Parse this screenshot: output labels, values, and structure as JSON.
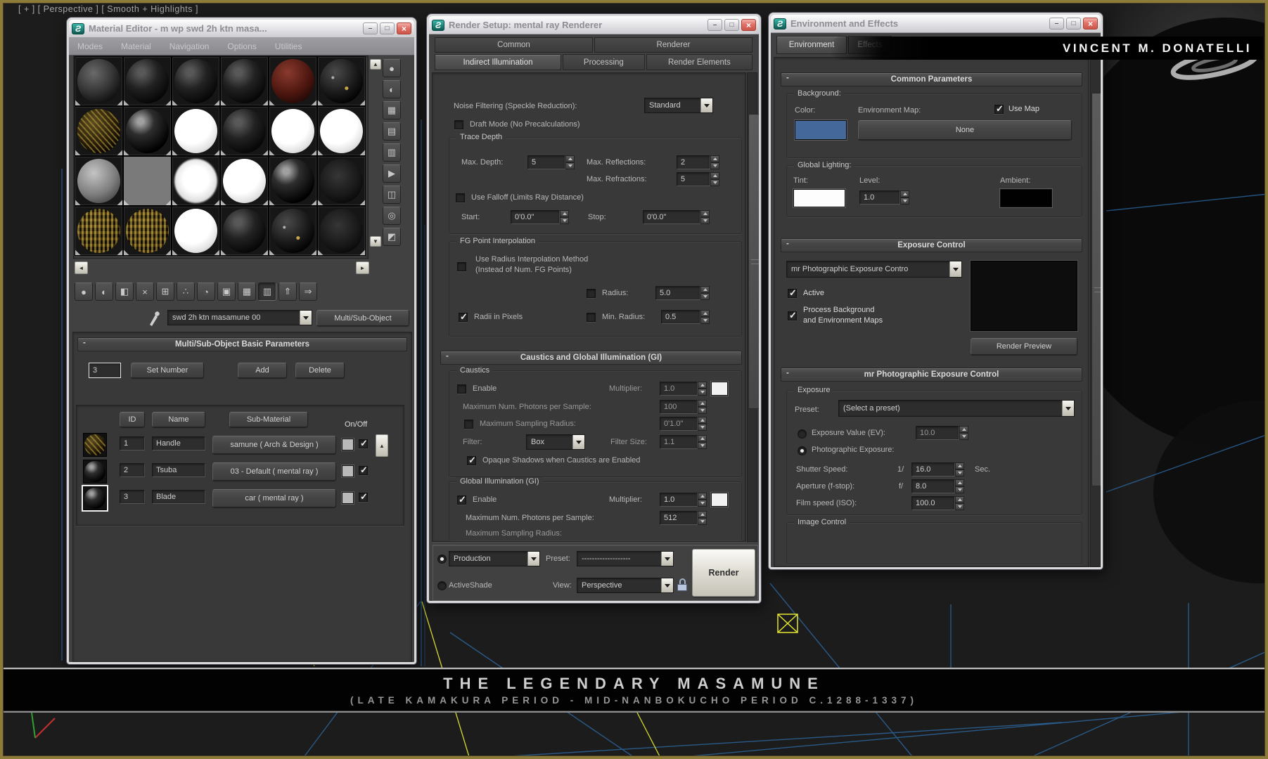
{
  "icons": {
    "minimize": "–",
    "maximize": "□",
    "close": "×",
    "check": "✓",
    "collapse": "-",
    "scroll_left": "◄",
    "scroll_right": "►",
    "scroll_up": "▲",
    "scroll_down": "▼",
    "dropdown_arrow": "▼",
    "app_logo": "Ƨ"
  },
  "colors": {
    "background_swatch": "#44689a",
    "tint_swatch": "#fdfdfd",
    "ambient_swatch": "#010101",
    "caustics_multiplier_swatch": "#f2f2f2",
    "gi_multiplier_swatch": "#f2f2f2",
    "sub_material_swatch": "#b9b9b9"
  },
  "viewport": {
    "label": "[ + ] [ Perspective ] [ Smooth + Highlights ]"
  },
  "overlay": {
    "credit": "VINCENT M. DONATELLI",
    "banner_title": "THE LEGENDARY MASAMUNE",
    "banner_subtitle": "(LATE KAMAKURA PERIOD - MID-NANBOKUCHO PERIOD C.1288-1337)"
  },
  "material_editor": {
    "title": "Material Editor - m wp swd 2h ktn masa...",
    "menus": [
      "Modes",
      "Material",
      "Navigation",
      "Options",
      "Utilities"
    ],
    "sample_slots": [
      "smoke",
      "black",
      "black",
      "black",
      "red",
      "speckle",
      "goldfleck",
      "gloss",
      "white",
      "black",
      "white",
      "white",
      "grey",
      "flat",
      "whitesoft",
      "white",
      "gloss",
      "darkdim",
      "gold",
      "gold",
      "white",
      "black",
      "speckle",
      "darkdim"
    ],
    "side_tools": [
      {
        "name": "sample-type",
        "glyph": "●"
      },
      {
        "name": "backlight",
        "glyph": "◐"
      },
      {
        "name": "background",
        "glyph": "▦"
      },
      {
        "name": "sample-uv-tiling",
        "glyph": "▤"
      },
      {
        "name": "video-color-check",
        "glyph": "▥"
      },
      {
        "name": "make-preview",
        "glyph": "▶"
      },
      {
        "name": "material-editor-options",
        "glyph": "◫"
      },
      {
        "name": "select-by-material",
        "glyph": "◎"
      },
      {
        "name": "material-map-navigator",
        "glyph": "◩"
      }
    ],
    "toolbar": [
      {
        "name": "get-material",
        "glyph": "●"
      },
      {
        "name": "put-material-to-scene",
        "glyph": "◐"
      },
      {
        "name": "assign-material-to-selection",
        "glyph": "◧"
      },
      {
        "name": "reset-map",
        "glyph": "×"
      },
      {
        "name": "make-material-copy",
        "glyph": "⊞"
      },
      {
        "name": "make-unique",
        "glyph": "∴"
      },
      {
        "name": "put-to-library",
        "glyph": "◔"
      },
      {
        "name": "material-id-channel",
        "glyph": "▣"
      },
      {
        "name": "show-map-in-viewport",
        "glyph": "▦"
      },
      {
        "name": "show-end-result",
        "glyph": "▥",
        "pressed": true
      },
      {
        "name": "go-to-parent",
        "glyph": "⇑"
      },
      {
        "name": "go-forward-to-sibling",
        "glyph": "⇒"
      }
    ],
    "material_name": "swd 2h ktn masamune 00",
    "type_button": "Multi/Sub-Object",
    "rollout": "Multi/Sub-Object Basic Parameters",
    "set_number": {
      "value": "3",
      "set_number_label": "Set Number",
      "add_label": "Add",
      "delete_label": "Delete"
    },
    "table": {
      "id_header": "ID",
      "name_header": "Name",
      "sub_header": "Sub-Material",
      "onoff_header": "On/Off",
      "rows": [
        {
          "id": "1",
          "name": "Handle",
          "sub": "samune  ( Arch & Design )",
          "thumb": "goldfleck",
          "on": true
        },
        {
          "id": "2",
          "name": "Tsuba",
          "sub": "03 - Default  ( mental ray )",
          "thumb": "gloss",
          "on": true
        },
        {
          "id": "3",
          "name": "Blade",
          "sub": "car  ( mental ray )",
          "thumb": "gloss",
          "on": true,
          "selected": true
        }
      ]
    }
  },
  "render_setup": {
    "title": "Render Setup: mental ray Renderer",
    "tabs_top": [
      "Common",
      "Renderer"
    ],
    "tabs_bottom": [
      "Indirect Illumination",
      "Processing",
      "Render Elements"
    ],
    "active_tab": "Indirect Illumination",
    "noise_filtering_label": "Noise Filtering (Speckle Reduction):",
    "noise_filtering_value": "Standard",
    "draft_mode": "Draft Mode (No Precalculations)",
    "trace_depth": {
      "title": "Trace Depth",
      "max_depth_label": "Max. Depth:",
      "max_depth": "5",
      "max_reflections_label": "Max. Reflections:",
      "max_reflections": "2",
      "max_refractions_label": "Max. Refractions:",
      "max_refractions": "5",
      "use_falloff": "Use Falloff (Limits Ray Distance)",
      "start_label": "Start:",
      "start": "0'0.0\"",
      "stop_label": "Stop:",
      "stop": "0'0.0\""
    },
    "fg_point": {
      "title": "FG Point Interpolation",
      "use_radius_line1": "Use Radius Interpolation Method",
      "use_radius_line2": "(Instead of Num. FG Points)",
      "radius_label": "Radius:",
      "radius": "5.0",
      "radii_in_pixels": "Radii in Pixels",
      "min_radius_label": "Min. Radius:",
      "min_radius": "0.5"
    },
    "cgi_rollout": "Caustics and Global Illumination (GI)",
    "caustics": {
      "title": "Caustics",
      "enable": "Enable",
      "multiplier_label": "Multiplier:",
      "multiplier": "1.0",
      "max_photons_label": "Maximum Num. Photons per Sample:",
      "max_photons": "100",
      "max_sampling_label": "Maximum Sampling Radius:",
      "max_sampling": "0'1.0\"",
      "filter_label": "Filter:",
      "filter": "Box",
      "filter_size_label": "Filter Size:",
      "filter_size": "1.1",
      "opaque": "Opaque Shadows when Caustics are Enabled"
    },
    "gi": {
      "title": "Global Illumination (GI)",
      "enable": "Enable",
      "multiplier_label": "Multiplier:",
      "multiplier": "1.0",
      "max_photons_label": "Maximum Num. Photons per Sample:",
      "max_photons": "512",
      "clipped_label": "Maximum Sampling Radius:"
    },
    "footer": {
      "production": "Production",
      "activeshade": "ActiveShade",
      "preset_label": "Preset:",
      "preset_value": "-------------------",
      "view_label": "View:",
      "view_value": "Perspective",
      "render": "Render"
    }
  },
  "environment": {
    "title": "Environment and Effects",
    "tabs": [
      "Environment",
      "Effects"
    ],
    "active_tab": "Environment",
    "common_params": "Common Parameters",
    "background": {
      "title": "Background:",
      "color_label": "Color:",
      "env_map_label": "Environment Map:",
      "use_map": "Use Map",
      "none": "None"
    },
    "global_lighting": {
      "title": "Global Lighting:",
      "tint_label": "Tint:",
      "level_label": "Level:",
      "level": "1.0",
      "ambient_label": "Ambient:"
    },
    "exposure_control": {
      "title": "Exposure Control",
      "dropdown": "mr Photographic Exposure Contro",
      "active": "Active",
      "process_line1": "Process Background",
      "process_line2": "and Environment Maps",
      "render_preview": "Render Preview"
    },
    "mr_exposure": {
      "title": "mr Photographic Exposure Control",
      "group": "Exposure",
      "preset_label": "Preset:",
      "preset": "(Select a preset)",
      "ev_label": "Exposure Value (EV):",
      "ev": "10.0",
      "photographic_label": "Photographic Exposure:",
      "shutter_label": "Shutter Speed:",
      "shutter_prefix": "1/",
      "shutter": "16.0",
      "shutter_suffix": "Sec.",
      "aperture_label": "Aperture (f-stop):",
      "aperture_prefix": "f/",
      "aperture": "8.0",
      "iso_label": "Film speed (ISO):",
      "iso": "100.0"
    },
    "image_control": "Image Control"
  }
}
